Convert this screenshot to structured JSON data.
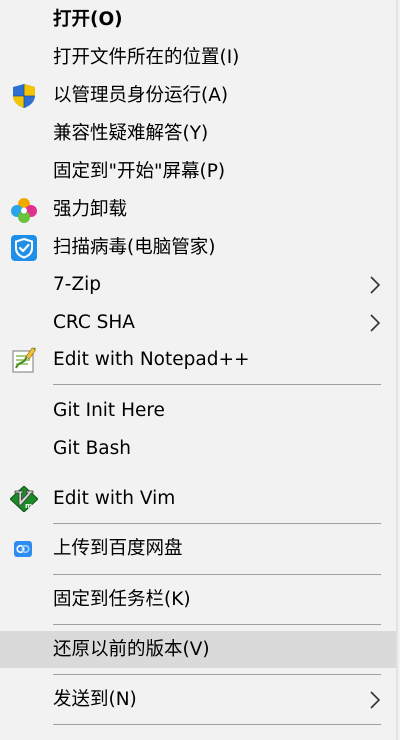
{
  "menu": {
    "items": [
      {
        "label": "打开(O)",
        "bold": true,
        "icon": null,
        "submenu": false
      },
      {
        "label": "打开文件所在的位置(I)",
        "icon": null,
        "submenu": false
      },
      {
        "label": "以管理员身份运行(A)",
        "icon": "uac-shield-icon",
        "submenu": false
      },
      {
        "label": "兼容性疑难解答(Y)",
        "icon": null,
        "submenu": false
      },
      {
        "label": "固定到\"开始\"屏幕(P)",
        "icon": null,
        "submenu": false
      },
      {
        "label": "强力卸载",
        "icon": "clover-uninstall-icon",
        "submenu": false
      },
      {
        "label": "扫描病毒(电脑管家)",
        "icon": "security-shield-icon",
        "submenu": false
      },
      {
        "label": "7-Zip",
        "icon": null,
        "submenu": true
      },
      {
        "label": "CRC SHA",
        "icon": null,
        "submenu": true
      },
      {
        "label": "Edit with Notepad++",
        "icon": "notepad-plus-plus-icon",
        "submenu": false
      },
      {
        "label": "Git Init Here",
        "icon": null,
        "submenu": false
      },
      {
        "label": "Git Bash",
        "icon": null,
        "submenu": false
      },
      {
        "label": "Edit with Vim",
        "icon": "vim-icon",
        "submenu": false
      },
      {
        "label": "上传到百度网盘",
        "icon": "baidu-netdisk-icon",
        "submenu": false
      },
      {
        "label": "固定到任务栏(K)",
        "icon": null,
        "submenu": false
      },
      {
        "label": "还原以前的版本(V)",
        "icon": null,
        "submenu": false,
        "highlighted": true
      },
      {
        "label": "发送到(N)",
        "icon": null,
        "submenu": true
      }
    ]
  },
  "colors": {
    "background": "#f2f2f2",
    "highlight": "#dadada",
    "separator": "#a0a0a0",
    "text": "#000000"
  }
}
